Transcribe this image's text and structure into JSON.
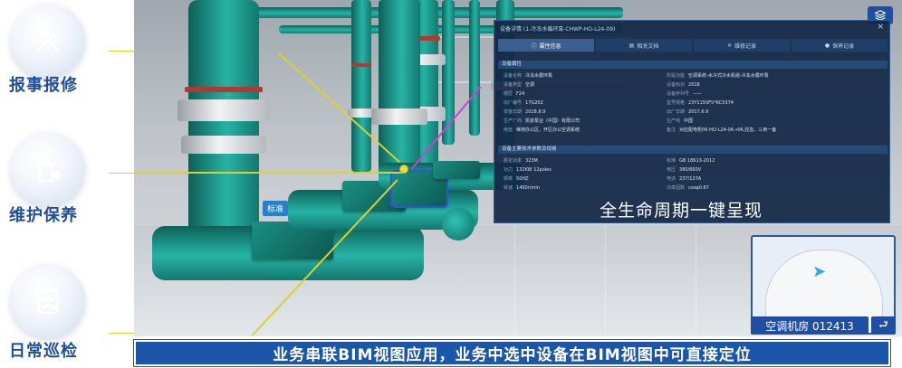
{
  "features": [
    {
      "label": "报事报修",
      "icon": "wrench-screwdriver-icon"
    },
    {
      "label": "维护保养",
      "icon": "oil-bottle-icon"
    },
    {
      "label": "日常巡检",
      "icon": "clipboard-check-icon"
    }
  ],
  "scene": {
    "tag_label": "标准"
  },
  "panel": {
    "title": "设备详情 (1-冷冻水循环泵-CHWP-HO-L24-09)",
    "close": "×",
    "tabs": [
      {
        "label": "属性信息",
        "icon": "info-icon",
        "active": true
      },
      {
        "label": "相关文档",
        "icon": "document-icon",
        "active": false
      },
      {
        "label": "维修记录",
        "icon": "tools-icon",
        "active": false
      },
      {
        "label": "保养记录",
        "icon": "person-icon",
        "active": false
      }
    ],
    "section1": "设备属性",
    "rows1_left": [
      {
        "k": "设备名称",
        "v": "冷冻水循环泵"
      },
      {
        "k": "设备类型",
        "v": "空调"
      },
      {
        "k": "楼层",
        "v": "F24"
      },
      {
        "k": "出厂编号",
        "v": "17G202"
      },
      {
        "k": "安装日期",
        "v": "2018.8.9"
      },
      {
        "k": "生产厂商",
        "v": "凯泉泵业（中国）有限公司"
      },
      {
        "k": "用途",
        "v": "维持办公区、开区办公空调系统"
      }
    ],
    "rows1_right": [
      {
        "k": "所属功能",
        "v": "空调系统-水冷式冷水机组-冷冻水循环泵"
      },
      {
        "k": "设备标识",
        "v": "2018"
      },
      {
        "k": "设备序列号",
        "v": "——"
      },
      {
        "k": "型号规格",
        "v": "23Y1150F5*KC5374"
      },
      {
        "k": "出厂日期",
        "v": "2017.6.9"
      },
      {
        "k": "生产地",
        "v": "中国"
      },
      {
        "k": "备注",
        "v": "对应配电柜06-HO-L24-06→06,应急、三用一备"
      }
    ],
    "section2": "设备主要技术参数及规格",
    "rows2_left": [
      {
        "k": "额定功率",
        "v": "323M"
      },
      {
        "k": "功力",
        "v": "132KW 12poles"
      },
      {
        "k": "频率",
        "v": "50HZ"
      },
      {
        "k": "转速",
        "v": "1450r/min"
      }
    ],
    "rows2_right": [
      {
        "k": "标准",
        "v": "GB 18613-2012"
      },
      {
        "k": "电压",
        "v": "380/660V"
      },
      {
        "k": "电流",
        "v": "237/137A"
      },
      {
        "k": "功率因数",
        "v": "cosφ0.87"
      }
    ],
    "caption": "全生命周期一键呈现"
  },
  "minimap": {
    "room_label": "空调机房 012413",
    "back_icon": "return-icon"
  },
  "banner": "业务串联BIM视图应用，业务中选中设备在BIM视图中可直接定位",
  "colors": {
    "brand_blue": "#1c56a8",
    "feature_text": "#1f4e9e",
    "pipe_teal": "#1c978b",
    "highlight_yellow": "#d9d12e",
    "pointer_magenta": "#cf3fcf"
  }
}
